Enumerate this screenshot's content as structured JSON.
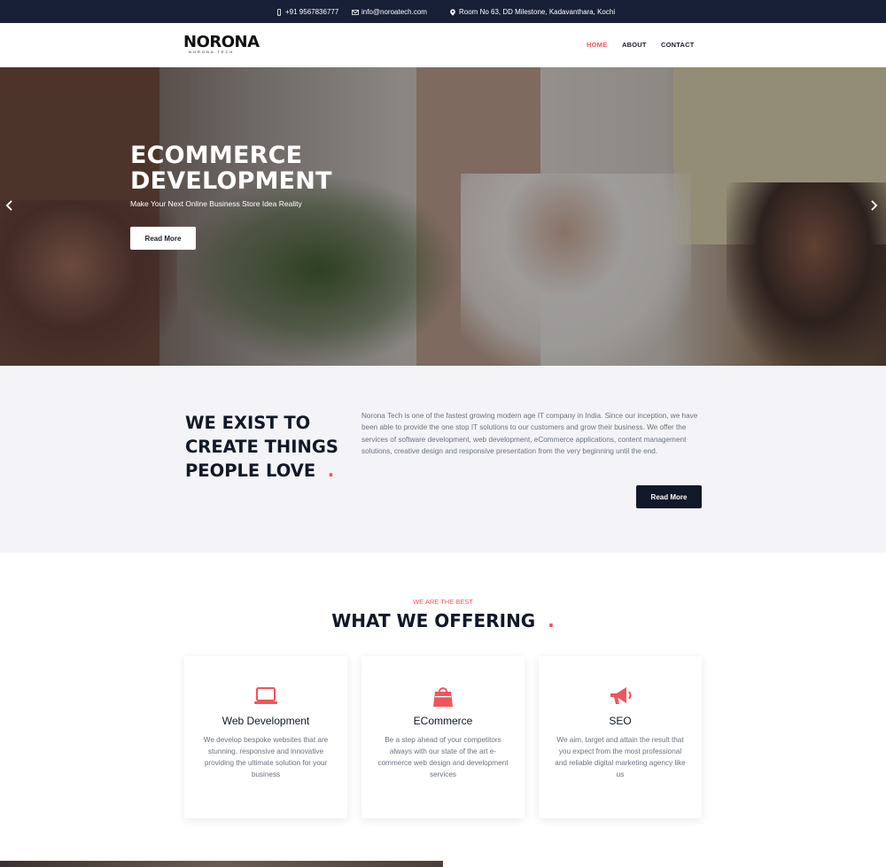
{
  "topbar": {
    "phone": "+91 9567836777",
    "email": "info@noroatech.com",
    "address": "Room No 63, DD Milestone, Kadavanthara, Kochi"
  },
  "header": {
    "logo_text": "NORONA",
    "logo_sub": "NORONA TECH",
    "nav": [
      "HOME",
      "ABOUT",
      "CONTACT"
    ]
  },
  "hero": {
    "title_line1": "ECOMMERCE",
    "title_line2": "DEVELOPMENT",
    "subtitle": "Make Your Next Online Business Store Idea Reality",
    "button": "Read More"
  },
  "about": {
    "title_line1": "WE EXIST TO",
    "title_line2": "CREATE THINGS",
    "title_line3": "PEOPLE LOVE",
    "dot": ".",
    "text": "Norona Tech is one of the fastest growing modern age IT company in India. Since our inception, we have been able to provide the one stop IT solutions to our customers and grow their business. We offer the services of software development, web development, eCommerce applications, content management solutions, creative design and responsive presentation from the very beginning until the end.",
    "button": "Read More"
  },
  "services": {
    "kicker": "WE ARE THE BEST",
    "title": "WHAT WE OFFERING",
    "dot": ".",
    "cards": [
      {
        "icon": "laptop-icon",
        "title": "Web Development",
        "desc": "We develop bespoke websites that are stunning, responsive and innovative providing the ultimate solution for your business"
      },
      {
        "icon": "shopping-bag-icon",
        "title": "ECommerce",
        "desc": "Be a step ahead of your competitors always with our state of the art e-commerce web design and development services"
      },
      {
        "icon": "megaphone-icon",
        "title": "SEO",
        "desc": "We aim, target and attain the result that you expect from the most professional and reliable digital marketing agency like us"
      }
    ]
  },
  "colors": {
    "accent": "#f2545b",
    "dark": "#111827",
    "topbar": "#172036"
  }
}
